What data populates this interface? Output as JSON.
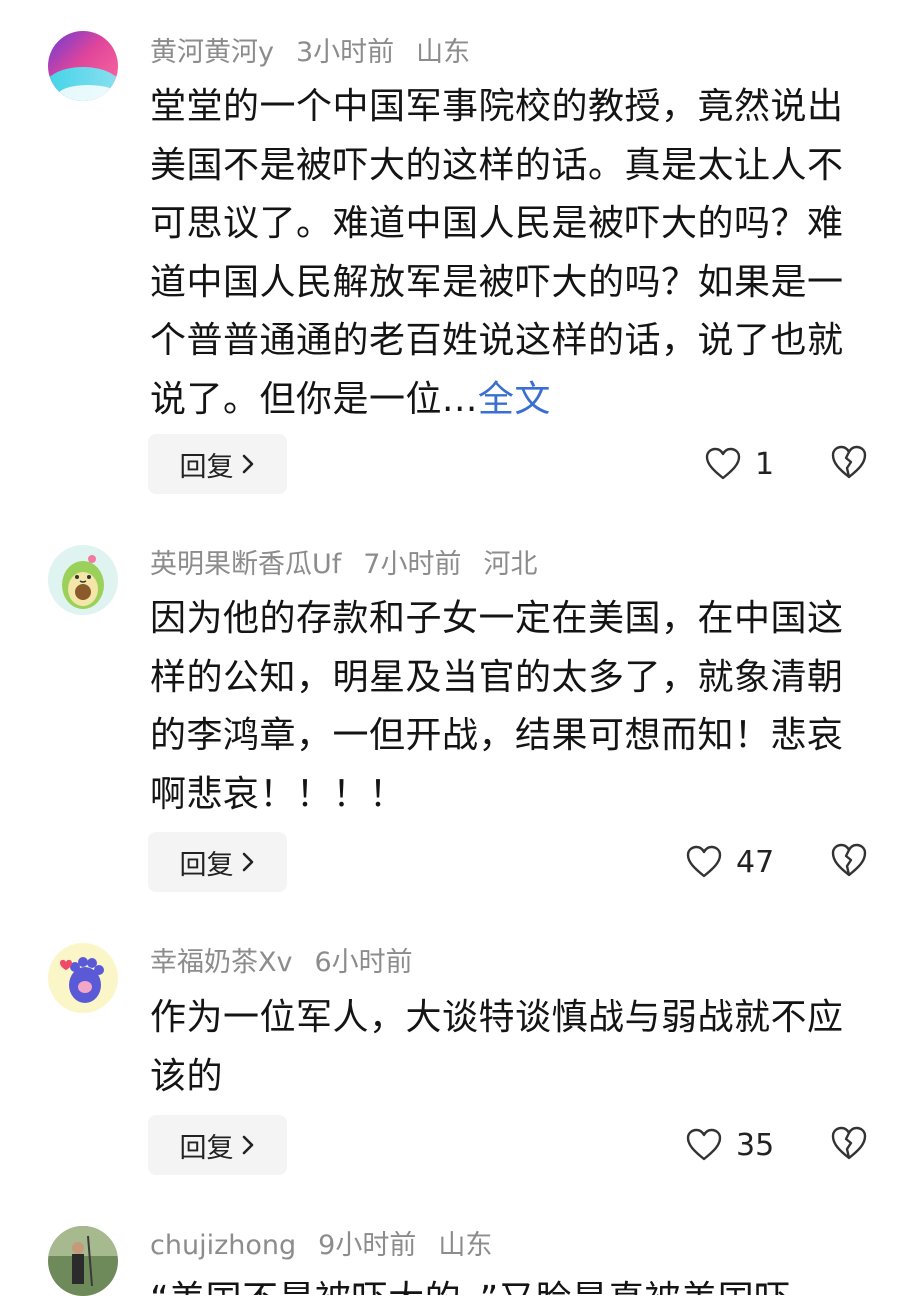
{
  "comments": [
    {
      "username": "黄河黄河y",
      "time": "3小时前",
      "location": "山东",
      "text": "堂堂的一个中国军事院校的教授，竟然说出美国不是被吓大的这样的话。真是太让人不可思议了。难道中国人民是被吓大的吗？难道中国人民解放军是被吓大的吗？如果是一个普普通通的老百姓说这样的话，说了也就说了。但你是一位...",
      "more_label": "全文",
      "reply_label": "回复",
      "likes": "1"
    },
    {
      "username": "英明果断香瓜Uf",
      "time": "7小时前",
      "location": "河北",
      "text": "因为他的存款和子女一定在美国，在中国这样的公知，明星及当官的太多了，就象清朝的李鸿章，一但开战，结果可想而知！悲哀啊悲哀！！！！",
      "reply_label": "回复",
      "likes": "47"
    },
    {
      "username": "幸福奶茶Xv",
      "time": "6小时前",
      "text": "作为一位军人，大谈特谈慎战与弱战就不应该的",
      "reply_label": "回复",
      "likes": "35"
    },
    {
      "username": "chujizhong",
      "time": "9小时前",
      "location": "山东",
      "text": "“美国不是被吓大的。”又脸是真被美国吓"
    }
  ],
  "icons": {
    "like": "heart-outline-icon",
    "dislike": "broken-heart-icon",
    "reply_chevron": "chevron-right-icon"
  },
  "colors": {
    "link": "#3a6fd1",
    "meta": "#8c8c8c",
    "text": "#141414",
    "button_bg": "#f4f4f4"
  }
}
